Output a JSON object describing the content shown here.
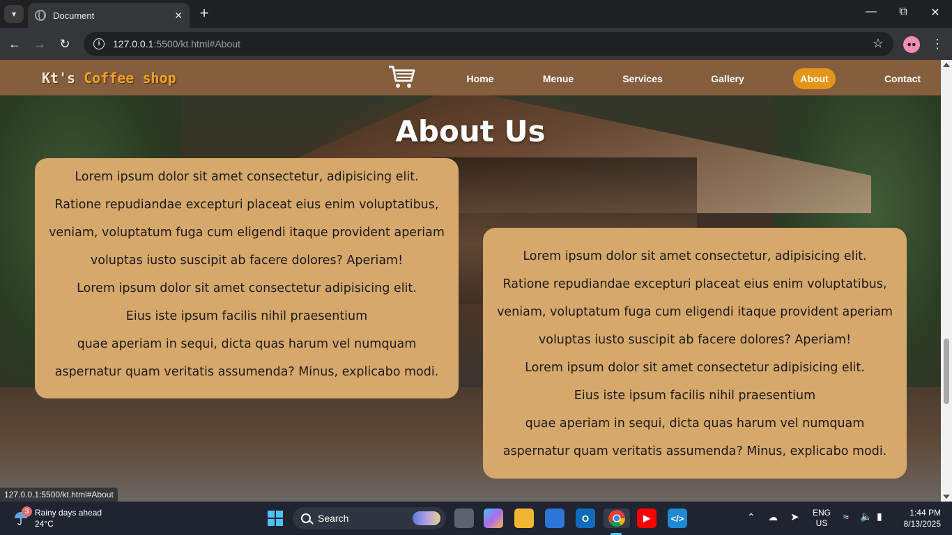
{
  "browser": {
    "tab_title": "Document",
    "url_host": "127.0.0.1",
    "url_path": ":5500/kt.html#About",
    "status_url": "127.0.0.1:5500/kt.html#About"
  },
  "site": {
    "logo_first": "Kt's",
    "logo_accent": "Coffee shop",
    "nav": [
      {
        "label": "Home"
      },
      {
        "label": "Menue"
      },
      {
        "label": "Services"
      },
      {
        "label": "Gallery"
      },
      {
        "label": "About",
        "active": true
      },
      {
        "label": "Contact"
      }
    ],
    "heading": "About Us",
    "card_lines": [
      "Lorem ipsum dolor sit amet consectetur, adipisicing elit.",
      "Ratione repudiandae excepturi placeat eius enim voluptatibus,",
      "veniam, voluptatum fuga cum eligendi itaque provident aperiam",
      "voluptas iusto suscipit ab facere dolores? Aperiam!",
      "Lorem ipsum dolor sit amet consectetur adipisicing elit.",
      "Eius iste ipsum facilis nihil praesentium",
      "quae aperiam in sequi, dicta quas harum vel numquam",
      "aspernatur quam veritatis assumenda? Minus, explicabo modi."
    ]
  },
  "colors": {
    "header_bg": "#8c623f",
    "accent": "#e49519",
    "card_bg": "#d6a86b"
  },
  "taskbar": {
    "weather_badge": "3",
    "weather_title": "Rainy days ahead",
    "weather_temp": "24°C",
    "search_label": "Search",
    "lang_top": "ENG",
    "lang_bottom": "US",
    "time": "1:44 PM",
    "date": "8/13/2025"
  }
}
